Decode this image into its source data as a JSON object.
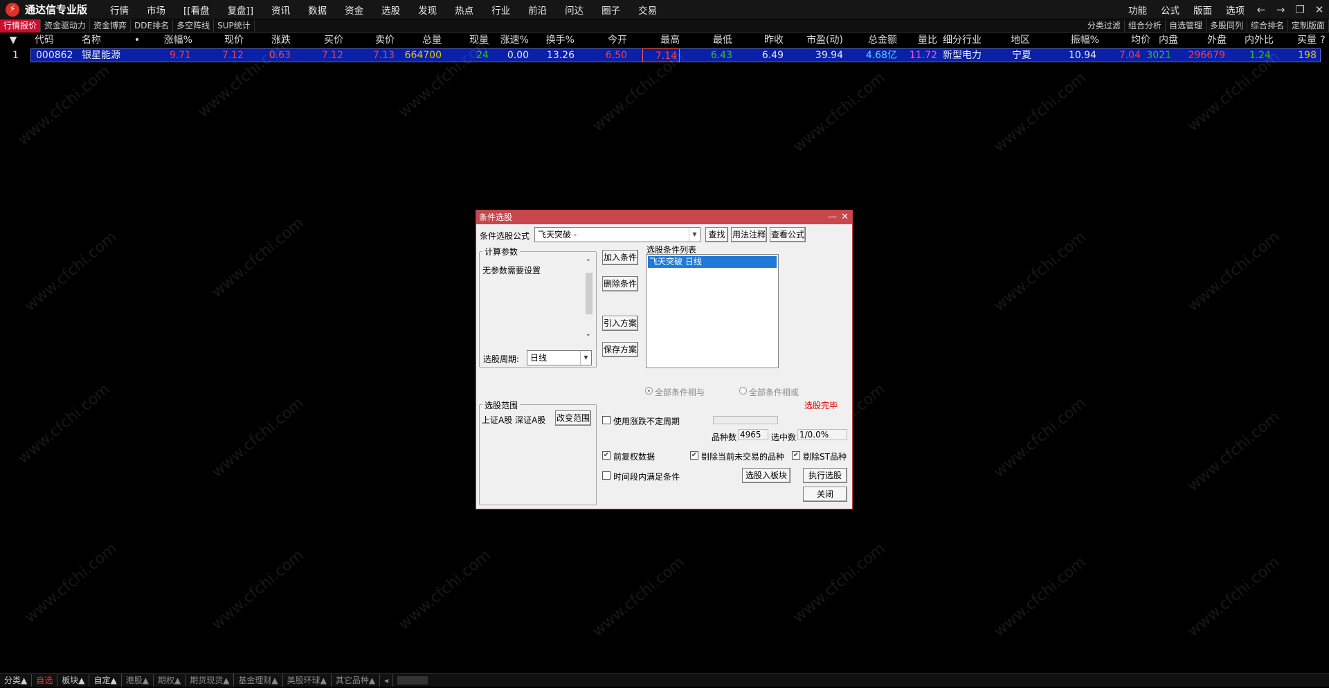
{
  "app": {
    "title": "通达信专业版",
    "logo_icon": "tdx-logo-icon"
  },
  "menu": [
    "行情",
    "市场",
    "[[看盘",
    "复盘]]",
    "资讯",
    "数据",
    "资金",
    "选股",
    "发现",
    "热点",
    "行业",
    "前沿",
    "问达",
    "圈子",
    "交易"
  ],
  "menu_right": [
    "功能",
    "公式",
    "版面",
    "选项"
  ],
  "window_controls": [
    "←",
    "→",
    "❐",
    "✕"
  ],
  "subtabs_left": [
    "行情报价",
    "资金驱动力",
    "资金博弈",
    "DDE排名",
    "多空阵线",
    "SUP统计"
  ],
  "subtabs_right": [
    "分类过滤",
    "组合分析",
    "自选管理",
    "多股同列",
    "综合排名",
    "定制版面"
  ],
  "table": {
    "headers": [
      "▼",
      "代码",
      "名称",
      "•",
      "涨幅%",
      "现价",
      "涨跌",
      "买价",
      "卖价",
      "总量",
      "现量",
      "涨速%",
      "换手%",
      "今开",
      "最高",
      "最低",
      "昨收",
      "市盈(动)",
      "总金额",
      "量比",
      "细分行业",
      "地区",
      "振幅%",
      "均价",
      "内盘",
      "外盘",
      "内外比",
      "买量",
      "?"
    ],
    "row": {
      "index": "1",
      "code": "000862",
      "name": "银星能源",
      "change_pct": "9.71",
      "price": "7.12",
      "change": "0.63",
      "bid": "7.12",
      "ask": "7.13",
      "volume": "664700",
      "cur_volume": "24",
      "speed": "0.00",
      "turnover": "13.26",
      "open": "6.50",
      "high": "7.14",
      "low": "6.43",
      "prev_close": "6.49",
      "pe": "39.94",
      "amount": "4.68亿",
      "vol_ratio": "11.72",
      "industry": "新型电力",
      "region": "宁夏",
      "amplitude": "10.94",
      "avg_price": "7.04",
      "inner": "3021",
      "outer": "296679",
      "in_out_ratio": "1.24",
      "bid_volume": "198"
    }
  },
  "watermark": "www.cfchi.com",
  "dialog": {
    "title": "条件选股",
    "minimize": "—",
    "close": "✕",
    "formula_label": "条件选股公式",
    "formula_value": "飞天突破     -",
    "btn_find": "查找",
    "btn_usage": "用法注释",
    "btn_view": "查看公式",
    "params_group": "计算参数",
    "params_text": "无参数需要设置",
    "period_label": "选股周期:",
    "period_value": "日线",
    "btn_add": "加入条件",
    "btn_delete": "删除条件",
    "btn_import": "引入方案",
    "btn_save": "保存方案",
    "conditions_label": "选股条件列表",
    "conditions": [
      "飞天突破  日线"
    ],
    "radio_and": "全部条件相与",
    "radio_or": "全部条件相或",
    "status": "选股完毕",
    "range_group": "选股范围",
    "range_text": "上证A股 深证A股",
    "btn_change_range": "改变范围",
    "use_uncertain_period": "使用涨跌不定周期",
    "count_label": "品种数",
    "count_value": "4965",
    "selected_label": "选中数",
    "selected_value": "1/0.0%",
    "chk_adjust": "前复权数据",
    "chk_remove_untraded": "剔除当前未交易的品种",
    "chk_remove_st": "剔除ST品种",
    "chk_time_range": "时间段内满足条件",
    "btn_to_block": "选股入板块",
    "btn_execute": "执行选股",
    "btn_close": "关闭"
  },
  "bottom_tabs": [
    "分类▲",
    "自选",
    "板块▲",
    "自定▲",
    "港股▲",
    "期权▲",
    "期货现货▲",
    "基金理财▲",
    "美股环球▲",
    "其它品种▲"
  ],
  "colors": {
    "rise": "#ff3b3b",
    "yellow": "#e6c800",
    "green": "#2ec02e",
    "cyan": "#4fd6ff",
    "magenta": "#ff4fd8",
    "selection_row": "#0a20a8",
    "dialog_title": "#c8464c"
  }
}
